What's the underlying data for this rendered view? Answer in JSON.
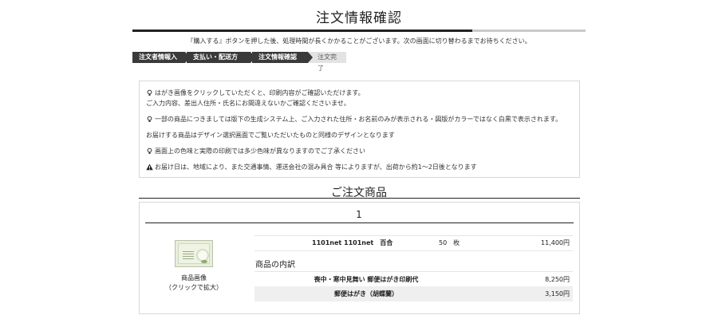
{
  "header": {
    "title": "注文情報確認",
    "notice": "『購入する』ボタンを押した後、処理時間が長くかかることがございます。次の画面に切り替わるまでお待ちください。"
  },
  "progress": {
    "fraction": 0.75,
    "steps": [
      {
        "label": "注文者情報入力",
        "state": "done"
      },
      {
        "label": "支払い・配送方法",
        "state": "done"
      },
      {
        "label": "注文情報確認",
        "state": "current"
      },
      {
        "label": "注文完了",
        "state": "todo"
      }
    ]
  },
  "info": {
    "line1a": "はがき画像をクリックしていただくと、印刷内容がご確認いただけます。",
    "line1b": "ご入力内容、差出人住所・氏名にお間違えないかご確認くださいませ。",
    "line2": "一部の商品につきましては版下の生成システム上、ご入力された住所・お名前のみが表示される・図版がカラーではなく白黒で表示されます。",
    "line3": "お届けする商品はデザイン選択画面でご覧いただいたものと同様のデザインとなります",
    "line4": "画面上の色味と実際の印刷では多少色味が異なりますのでご了承ください",
    "line5": "お届け日は、地域により、また交通事情、運送会社の混み具合 等によりますが、出荷から約1〜2日後となります",
    "icons": [
      "lightbulb-icon",
      "lightbulb-icon",
      "lightbulb-icon",
      "warning-icon"
    ]
  },
  "order": {
    "section_title": "ご注文商品",
    "item_number": "1",
    "thumb_caption_1": "商品画像",
    "thumb_caption_2": "（クリックで拡大）",
    "product": {
      "name": "1101net 1101net　百合",
      "quantity": "50　枚",
      "price": "11,400円"
    },
    "breakdown_title": "商品の内訳",
    "breakdown": [
      {
        "label": "喪中・寒中見舞い 郵便はがき印刷代",
        "amount": "8,250円"
      },
      {
        "label": "郵便はがき（胡蝶蘭）",
        "amount": "3,150円"
      }
    ]
  }
}
